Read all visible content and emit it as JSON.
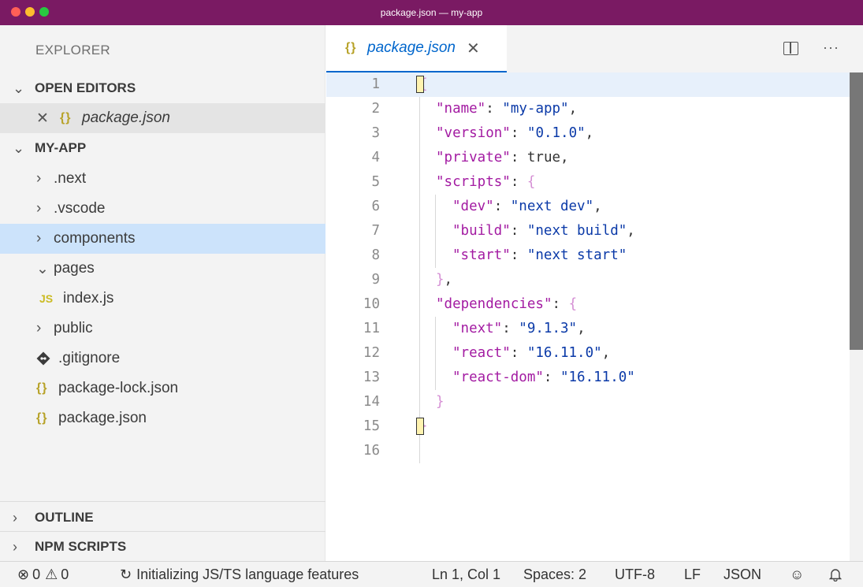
{
  "window": {
    "title": "package.json — my-app"
  },
  "sidebar": {
    "header": "EXPLORER",
    "open_editors": {
      "label": "OPEN EDITORS",
      "items": [
        {
          "name": "package.json",
          "icon": "json-braces-icon"
        }
      ]
    },
    "project": {
      "label": "MY-APP",
      "items": [
        {
          "name": ".next",
          "kind": "folder",
          "state": "collapsed"
        },
        {
          "name": ".vscode",
          "kind": "folder",
          "state": "collapsed"
        },
        {
          "name": "components",
          "kind": "folder",
          "state": "collapsed",
          "selected": true
        },
        {
          "name": "pages",
          "kind": "folder",
          "state": "expanded"
        },
        {
          "name": "index.js",
          "kind": "file",
          "icon": "JS"
        },
        {
          "name": "public",
          "kind": "folder",
          "state": "collapsed"
        },
        {
          "name": ".gitignore",
          "kind": "file",
          "icon": "git-icon"
        },
        {
          "name": "package-lock.json",
          "kind": "file",
          "icon": "{}"
        },
        {
          "name": "package.json",
          "kind": "file",
          "icon": "{}"
        }
      ]
    },
    "outline": {
      "label": "OUTLINE"
    },
    "npm_scripts": {
      "label": "NPM SCRIPTS"
    }
  },
  "icons": {
    "folder_chevron": "›",
    "json": "{}",
    "js": "JS"
  },
  "editor": {
    "tab": {
      "label": "package.json",
      "icon": "{}"
    },
    "line_numbers": [
      "1",
      "2",
      "3",
      "4",
      "5",
      "6",
      "7",
      "8",
      "9",
      "10",
      "11",
      "12",
      "13",
      "14",
      "15",
      "16"
    ],
    "lines": [
      {
        "tokens": [
          {
            "t": "{",
            "c": "brace"
          }
        ]
      },
      {
        "tokens": [
          {
            "t": "\"name\"",
            "c": "key"
          },
          {
            "t": ": ",
            "c": "pun"
          },
          {
            "t": "\"my-app\"",
            "c": "str"
          },
          {
            "t": ",",
            "c": "pun"
          }
        ]
      },
      {
        "tokens": [
          {
            "t": "\"version\"",
            "c": "key"
          },
          {
            "t": ": ",
            "c": "pun"
          },
          {
            "t": "\"0.1.0\"",
            "c": "str"
          },
          {
            "t": ",",
            "c": "pun"
          }
        ]
      },
      {
        "tokens": [
          {
            "t": "\"private\"",
            "c": "key"
          },
          {
            "t": ": true,",
            "c": "pun"
          }
        ]
      },
      {
        "tokens": [
          {
            "t": "\"scripts\"",
            "c": "key"
          },
          {
            "t": ": ",
            "c": "pun"
          },
          {
            "t": "{",
            "c": "brace"
          }
        ]
      },
      {
        "tokens": [
          {
            "t": "\"dev\"",
            "c": "key"
          },
          {
            "t": ": ",
            "c": "pun"
          },
          {
            "t": "\"next dev\"",
            "c": "str"
          },
          {
            "t": ",",
            "c": "pun"
          }
        ]
      },
      {
        "tokens": [
          {
            "t": "\"build\"",
            "c": "key"
          },
          {
            "t": ": ",
            "c": "pun"
          },
          {
            "t": "\"next build\"",
            "c": "str"
          },
          {
            "t": ",",
            "c": "pun"
          }
        ]
      },
      {
        "tokens": [
          {
            "t": "\"start\"",
            "c": "key"
          },
          {
            "t": ": ",
            "c": "pun"
          },
          {
            "t": "\"next start\"",
            "c": "str"
          }
        ]
      },
      {
        "tokens": [
          {
            "t": "}",
            "c": "brace"
          },
          {
            "t": ",",
            "c": "pun"
          }
        ]
      },
      {
        "tokens": [
          {
            "t": "\"dependencies\"",
            "c": "key"
          },
          {
            "t": ": ",
            "c": "pun"
          },
          {
            "t": "{",
            "c": "brace"
          }
        ]
      },
      {
        "tokens": [
          {
            "t": "\"next\"",
            "c": "key"
          },
          {
            "t": ": ",
            "c": "pun"
          },
          {
            "t": "\"9.1.3\"",
            "c": "str"
          },
          {
            "t": ",",
            "c": "pun"
          }
        ]
      },
      {
        "tokens": [
          {
            "t": "\"react\"",
            "c": "key"
          },
          {
            "t": ": ",
            "c": "pun"
          },
          {
            "t": "\"16.11.0\"",
            "c": "str"
          },
          {
            "t": ",",
            "c": "pun"
          }
        ]
      },
      {
        "tokens": [
          {
            "t": "\"react-dom\"",
            "c": "key"
          },
          {
            "t": ": ",
            "c": "pun"
          },
          {
            "t": "\"16.11.0\"",
            "c": "str"
          }
        ]
      },
      {
        "tokens": [
          {
            "t": "}",
            "c": "brace"
          }
        ]
      },
      {
        "tokens": [
          {
            "t": "}",
            "c": "brace"
          }
        ]
      },
      {
        "tokens": []
      }
    ]
  },
  "statusbar": {
    "errors": "0",
    "warnings": "0",
    "task": "Initializing JS/TS language features",
    "cursor": "Ln 1, Col 1",
    "indent": "Spaces: 2",
    "encoding": "UTF-8",
    "eol": "LF",
    "language": "JSON"
  },
  "colors": {
    "titlebar": "#7a1a63",
    "accent": "#0066cc",
    "selection": "#cce3fb",
    "json_key": "#a31ba2",
    "json_string": "#0b3aa8"
  }
}
